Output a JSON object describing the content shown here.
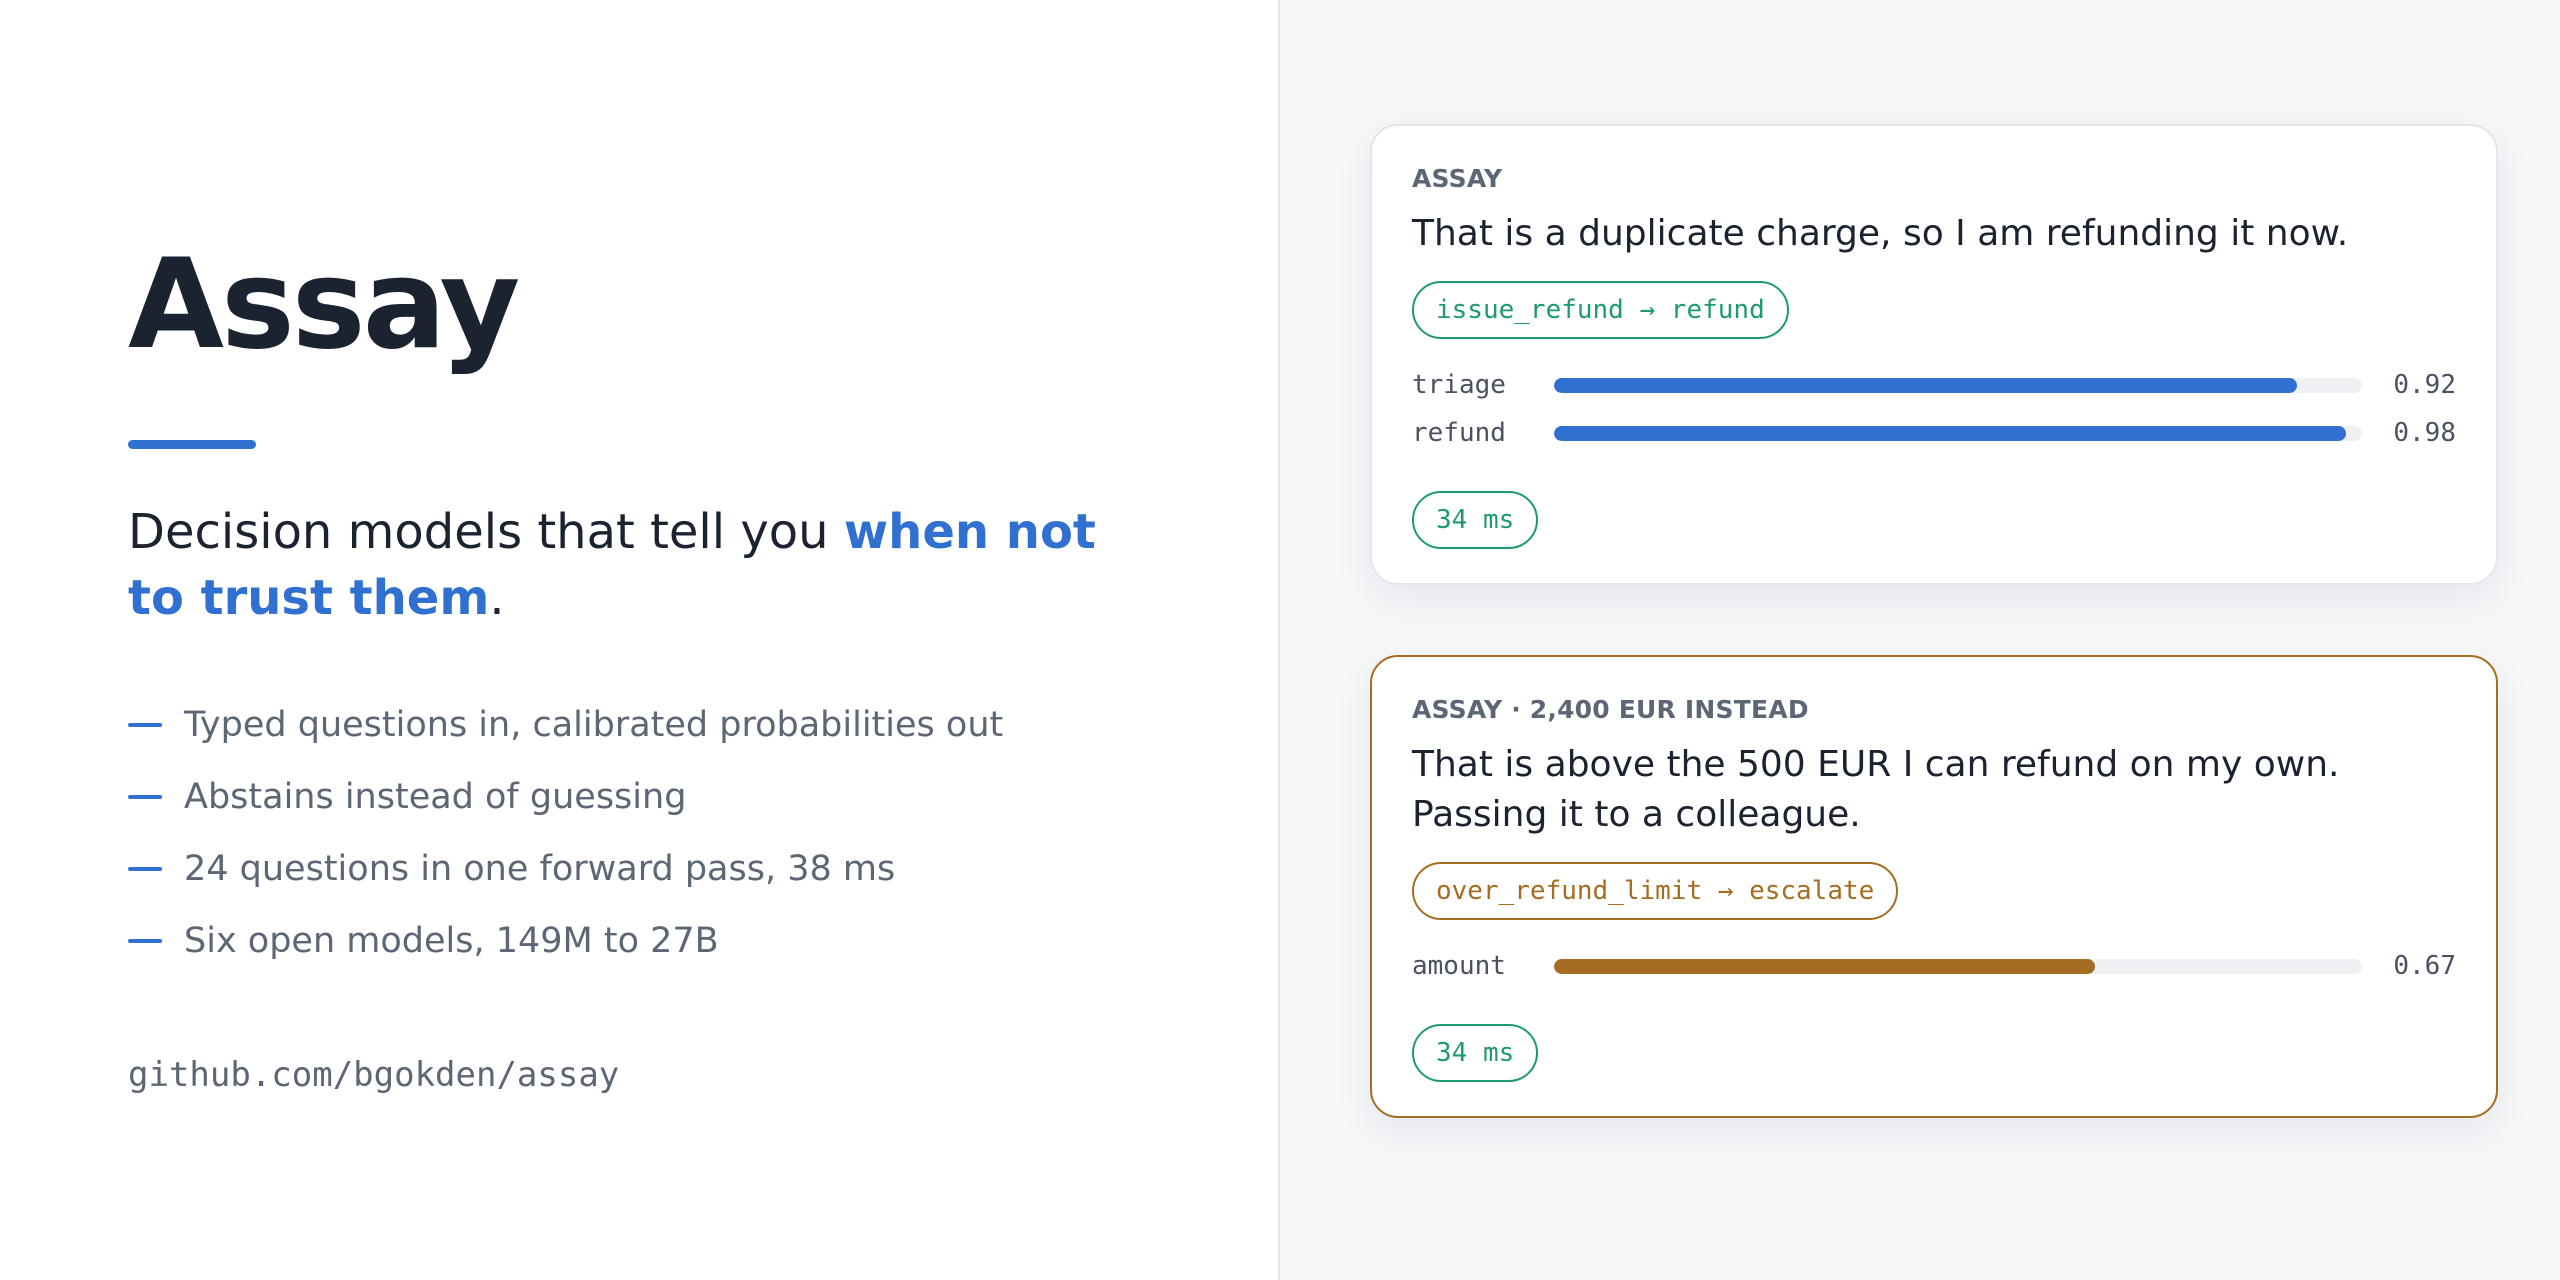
{
  "brand": {
    "title": "Assay",
    "accent_color": "#3070d0"
  },
  "tagline": {
    "prefix": "Decision models that tell you ",
    "highlight": "when not to trust them",
    "suffix": "."
  },
  "features": [
    "Typed questions in, calibrated probabilities out",
    "Abstains instead of guessing",
    "24 questions in one forward pass, 38 ms",
    "Six open models, 149M to 27B"
  ],
  "repo": "github.com/bgokden/assay",
  "cards": [
    {
      "label": "ASSAY",
      "message": "That is a duplicate charge, so I am refunding it now.",
      "decision": "issue_refund → refund",
      "status": "normal",
      "accent_color": "#3070d0",
      "metrics": [
        {
          "name": "triage",
          "value": 0.92,
          "display": "0.92"
        },
        {
          "name": "refund",
          "value": 0.98,
          "display": "0.98"
        }
      ],
      "latency": "34 ms"
    },
    {
      "label": "ASSAY · 2,400 EUR INSTEAD",
      "message": "That is above the 500 EUR I can refund on my own. Passing it to a colleague.",
      "decision": "over_refund_limit → escalate",
      "status": "escalate",
      "accent_color": "#a66d22",
      "metrics": [
        {
          "name": "amount",
          "value": 0.67,
          "display": "0.67"
        }
      ],
      "latency": "34 ms"
    }
  ],
  "colors": {
    "success": "#1f9a6e",
    "warning": "#a66d22",
    "text_dark": "#1b2230",
    "text_muted": "#5c6675"
  }
}
